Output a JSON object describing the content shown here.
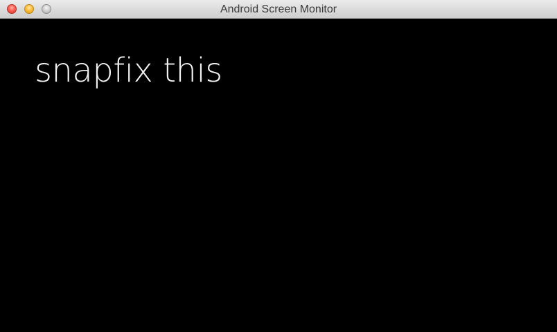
{
  "window": {
    "title": "Android Screen Monitor"
  },
  "screen": {
    "text": "snapfix this"
  }
}
